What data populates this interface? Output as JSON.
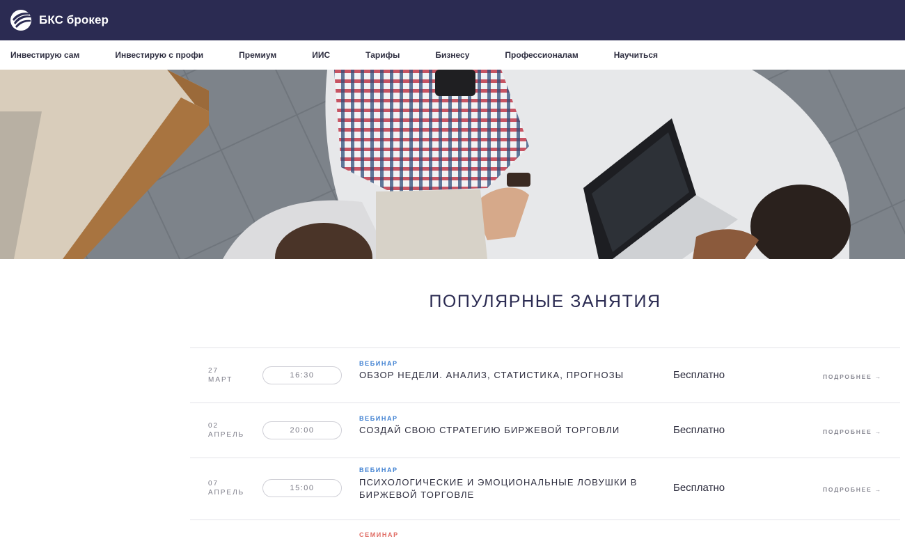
{
  "brand": {
    "name": "БКС брокер"
  },
  "nav": {
    "items": [
      {
        "label": "Инвестирую сам"
      },
      {
        "label": "Инвестирую с профи"
      },
      {
        "label": "Премиум"
      },
      {
        "label": "ИИС"
      },
      {
        "label": "Тарифы"
      },
      {
        "label": "Бизнесу"
      },
      {
        "label": "Профессионалам"
      },
      {
        "label": "Научиться"
      }
    ]
  },
  "section": {
    "title": "ПОПУЛЯРНЫЕ ЗАНЯТИЯ"
  },
  "events": [
    {
      "day": "27",
      "month": "МАРТ",
      "time": "16:30",
      "kind": "ВЕБИНАР",
      "title": "ОБЗОР НЕДЕЛИ. АНАЛИЗ, СТАТИСТИКА, ПРОГНОЗЫ",
      "price": "Бесплатно",
      "more": "ПОДРОБНЕЕ →"
    },
    {
      "day": "02",
      "month": "АПРЕЛЬ",
      "time": "20:00",
      "kind": "ВЕБИНАР",
      "title": "СОЗДАЙ СВОЮ СТРАТЕГИЮ БИРЖЕВОЙ ТОРГОВЛИ",
      "price": "Бесплатно",
      "more": "ПОДРОБНЕЕ →"
    },
    {
      "day": "07",
      "month": "АПРЕЛЬ",
      "time": "15:00",
      "kind": "ВЕБИНАР",
      "title": "ПСИХОЛОГИЧЕСКИЕ И ЭМОЦИОНАЛЬНЫЕ ЛОВУШКИ В БИРЖЕВОЙ ТОРГОВЛЕ",
      "price": "Бесплатно",
      "more": "ПОДРОБНЕЕ →"
    },
    {
      "kind": "СЕМИНАР"
    }
  ],
  "colors": {
    "header_bg": "#2b2b52",
    "accent_webinar": "#3d7fd1",
    "accent_seminar": "#e06b63"
  },
  "icons": {
    "logo": "bks-wave-logo-icon"
  }
}
